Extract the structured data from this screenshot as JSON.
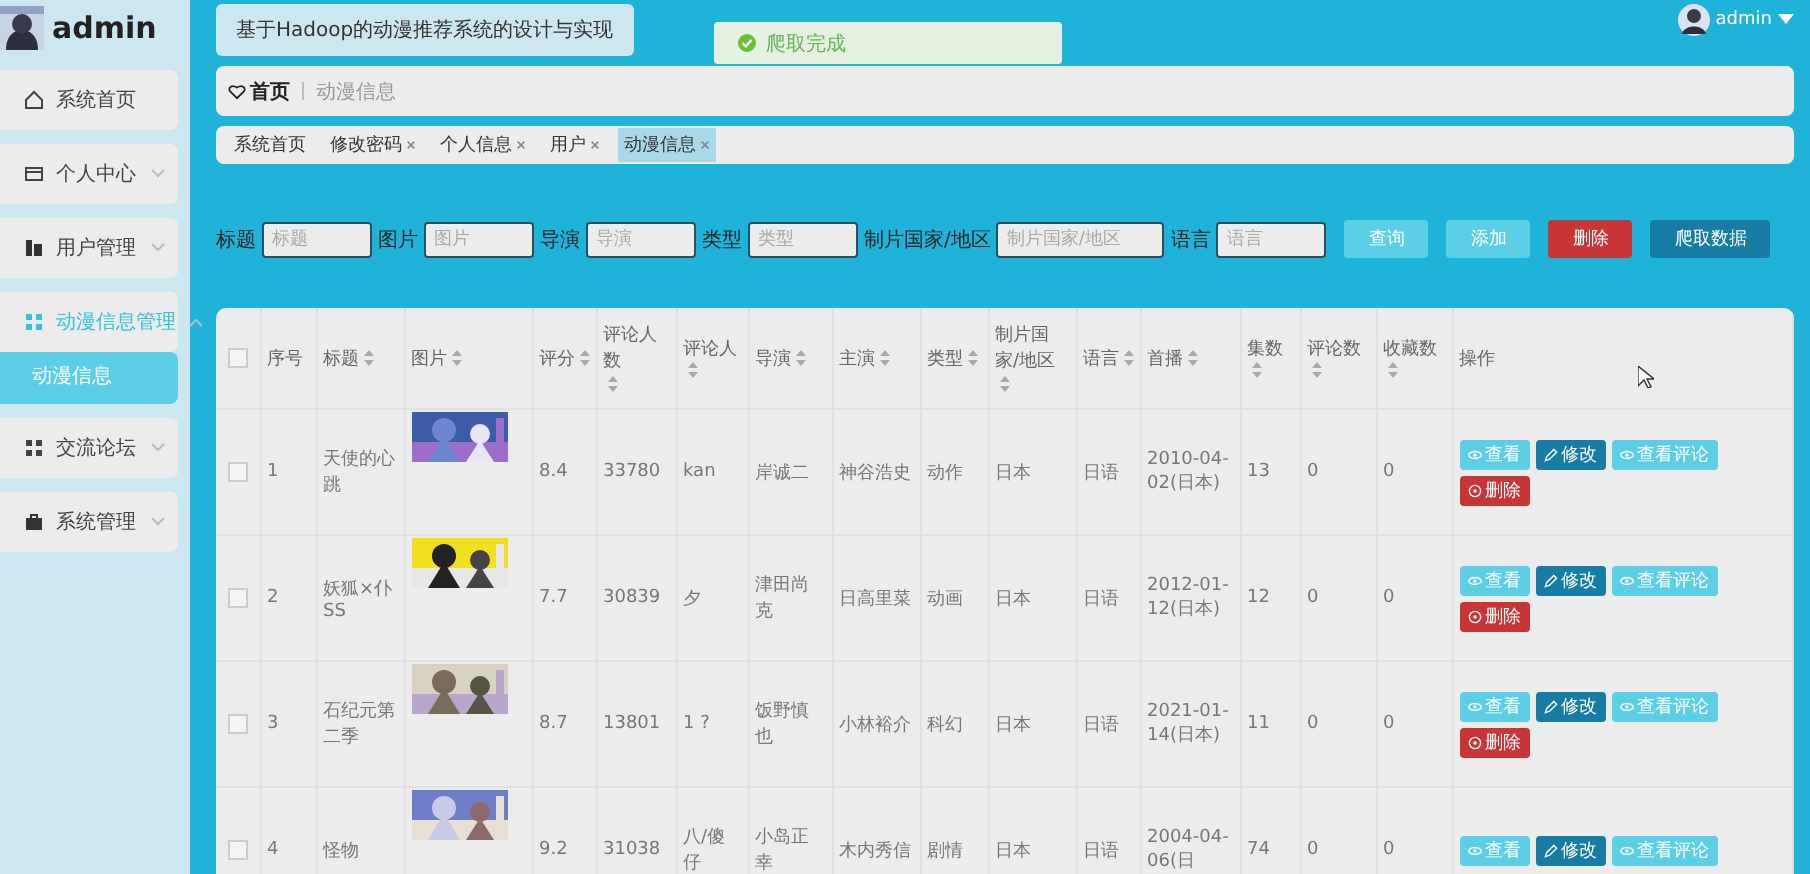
{
  "sidebar": {
    "user": "admin",
    "items": [
      {
        "label": "系统首页",
        "expandable": false,
        "expanded": false
      },
      {
        "label": "个人中心",
        "expandable": true,
        "expanded": false
      },
      {
        "label": "用户管理",
        "expandable": true,
        "expanded": false
      },
      {
        "label": "动漫信息管理",
        "expandable": true,
        "expanded": true,
        "children": [
          {
            "label": "动漫信息",
            "selected": true
          }
        ]
      },
      {
        "label": "交流论坛",
        "expandable": true,
        "expanded": false
      },
      {
        "label": "系统管理",
        "expandable": true,
        "expanded": false
      }
    ]
  },
  "header": {
    "title": "基于Hadoop的动漫推荐系统的设计与实现",
    "user": "admin"
  },
  "toast": {
    "message": "爬取完成"
  },
  "breadcrumb": {
    "home": "首页",
    "current": "动漫信息"
  },
  "tags": [
    {
      "label": "系统首页",
      "closable": false,
      "selected": false
    },
    {
      "label": "修改密码",
      "closable": true,
      "selected": false
    },
    {
      "label": "个人信息",
      "closable": true,
      "selected": false
    },
    {
      "label": "用户",
      "closable": true,
      "selected": false
    },
    {
      "label": "动漫信息",
      "closable": true,
      "selected": true
    }
  ],
  "search": {
    "fields": [
      {
        "label": "标题",
        "placeholder": "标题"
      },
      {
        "label": "图片",
        "placeholder": "图片"
      },
      {
        "label": "导演",
        "placeholder": "导演"
      },
      {
        "label": "类型",
        "placeholder": "类型"
      },
      {
        "label": "制片国家/地区",
        "placeholder": "制片国家/地区"
      },
      {
        "label": "语言",
        "placeholder": "语言"
      }
    ],
    "buttons": [
      {
        "label": "查询",
        "kind": "query"
      },
      {
        "label": "添加",
        "kind": "add"
      },
      {
        "label": "删除",
        "kind": "delete"
      },
      {
        "label": "爬取数据",
        "kind": "crawl"
      }
    ]
  },
  "table": {
    "header_checked": false,
    "columns": [
      {
        "label": "序号",
        "sortable": false
      },
      {
        "label": "标题",
        "sortable": true
      },
      {
        "label": "图片",
        "sortable": true
      },
      {
        "label": "评分",
        "sortable": true
      },
      {
        "label": "评论人数",
        "sortable": true
      },
      {
        "label": "评论人",
        "sortable": true
      },
      {
        "label": "导演",
        "sortable": true
      },
      {
        "label": "主演",
        "sortable": true
      },
      {
        "label": "类型",
        "sortable": true
      },
      {
        "label": "制片国家/地区",
        "sortable": true
      },
      {
        "label": "语言",
        "sortable": true
      },
      {
        "label": "首播",
        "sortable": true
      },
      {
        "label": "集数",
        "sortable": true
      },
      {
        "label": "评论数",
        "sortable": true
      },
      {
        "label": "收藏数",
        "sortable": true
      },
      {
        "label": "操作",
        "sortable": false
      }
    ],
    "rows": [
      {
        "checked": false,
        "cells": [
          "1",
          "天使的心跳",
          {
            "kind": "picture"
          },
          "8.4",
          "33780",
          "kan",
          "岸诚二",
          "神谷浩史",
          "动作",
          "日本",
          "日语",
          "2010-04-02(日本)",
          "13",
          "0",
          "0"
        ],
        "actions": [
          {
            "label": "查看",
            "kind": "view"
          },
          {
            "label": "修改",
            "kind": "edit"
          },
          {
            "label": "查看评论",
            "kind": "comments"
          },
          {
            "label": "删除",
            "kind": "delete"
          }
        ]
      },
      {
        "checked": false,
        "cells": [
          "2",
          "妖狐×仆SS",
          {
            "kind": "picture"
          },
          "7.7",
          "30839",
          "夕",
          "津田尚克",
          "日高里菜",
          "动画",
          "日本",
          "日语",
          "2012-01-12(日本)",
          "12",
          "0",
          "0"
        ],
        "actions": [
          {
            "label": "查看",
            "kind": "view"
          },
          {
            "label": "修改",
            "kind": "edit"
          },
          {
            "label": "查看评论",
            "kind": "comments"
          },
          {
            "label": "删除",
            "kind": "delete"
          }
        ]
      },
      {
        "checked": false,
        "cells": [
          "3",
          "石纪元第二季",
          {
            "kind": "picture"
          },
          "8.7",
          "13801",
          "1 ?",
          "饭野慎也",
          "小林裕介",
          "科幻",
          "日本",
          "日语",
          "2021-01-14(日本)",
          "11",
          "0",
          "0"
        ],
        "actions": [
          {
            "label": "查看",
            "kind": "view"
          },
          {
            "label": "修改",
            "kind": "edit"
          },
          {
            "label": "查看评论",
            "kind": "comments"
          },
          {
            "label": "删除",
            "kind": "delete"
          }
        ]
      },
      {
        "checked": false,
        "cells": [
          "4",
          "怪物",
          {
            "kind": "picture"
          },
          "9.2",
          "31038",
          "八/傻仔",
          "小岛正幸",
          "木内秀信",
          "剧情",
          "日本",
          "日语",
          "2004-04-06(日",
          "74",
          "0",
          "0"
        ],
        "actions": [
          {
            "label": "查看",
            "kind": "view"
          },
          {
            "label": "修改",
            "kind": "edit"
          },
          {
            "label": "查看评论",
            "kind": "comments"
          }
        ]
      }
    ]
  }
}
